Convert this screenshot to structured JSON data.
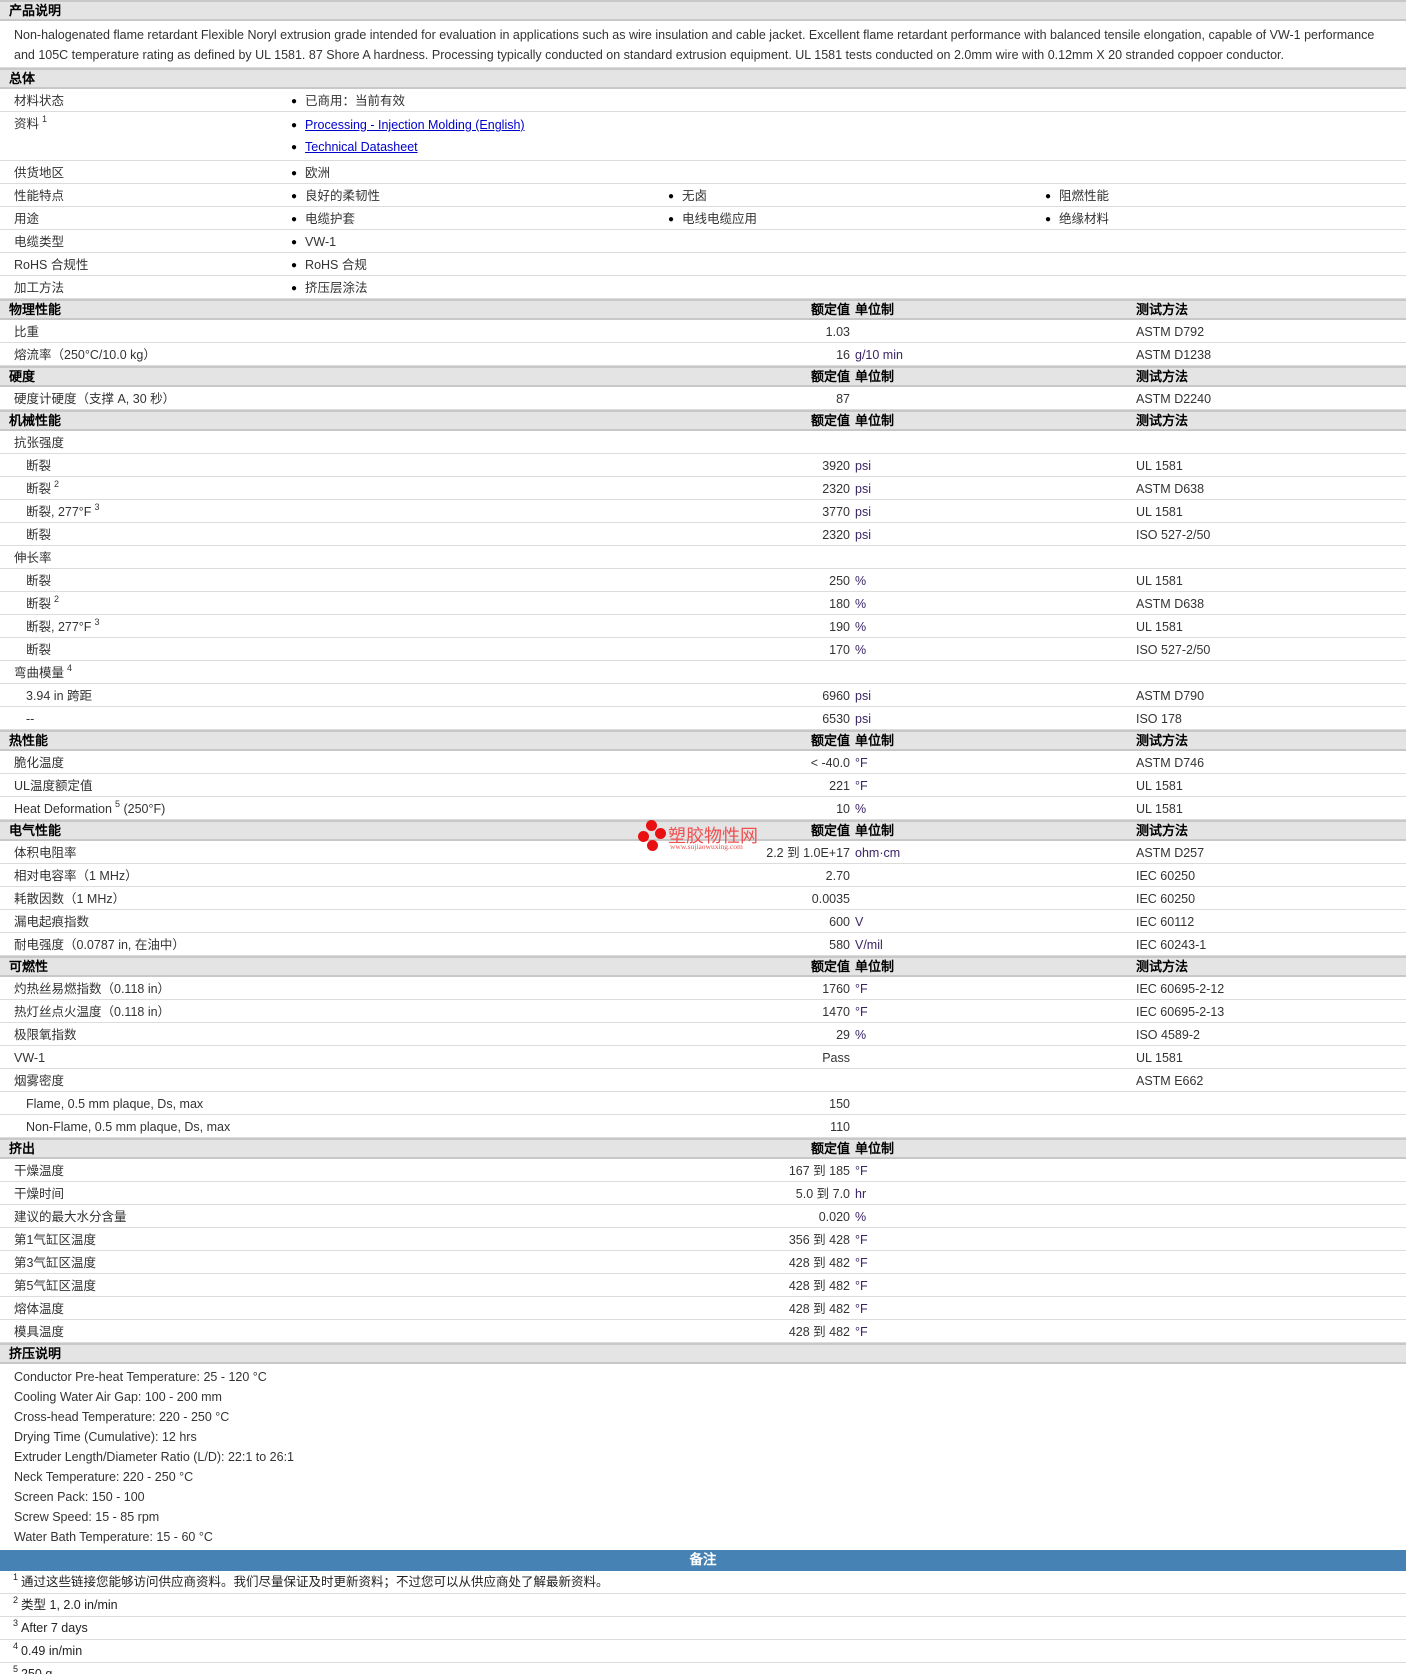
{
  "description": {
    "title": "产品说明",
    "text": "Non-halogenated flame retardant Flexible Noryl extrusion grade intended for evaluation in applications such as wire insulation and cable jacket. Excellent flame retardant performance with balanced tensile elongation, capable of VW-1 performance and 105C temperature rating as defined by UL 1581. 87 Shore A hardness. Processing typically conducted on standard extrusion equipment. UL 1581 tests conducted on 2.0mm wire with 0.12mm X 20 stranded coppoer conductor."
  },
  "general": {
    "title": "总体",
    "rows": [
      {
        "label": "材料状态",
        "items": [
          "已商用：当前有效"
        ]
      },
      {
        "label": "资料",
        "sup": "1",
        "links": [
          "Processing - Injection Molding (English)",
          "Technical Datasheet"
        ]
      },
      {
        "label": "供货地区",
        "items": [
          "欧洲"
        ]
      },
      {
        "label": "性能特点",
        "items": [
          "良好的柔韧性",
          "无卤",
          "阻燃性能"
        ]
      },
      {
        "label": "用途",
        "items": [
          "电缆护套",
          "电线电缆应用",
          "绝缘材料"
        ]
      },
      {
        "label": "电缆类型",
        "items": [
          "VW-1"
        ]
      },
      {
        "label": "RoHS 合规性",
        "items": [
          "RoHS 合规"
        ]
      },
      {
        "label": "加工方法",
        "items": [
          "挤压层涂法"
        ]
      }
    ]
  },
  "columns": {
    "value": "额定值",
    "unit": "单位制",
    "method": "测试方法"
  },
  "sections": [
    {
      "title": "物理性能",
      "method_col": true,
      "rows": [
        {
          "label": "比重",
          "value": "1.03",
          "unit": "",
          "method": "ASTM D792"
        },
        {
          "label": "熔流率（250°C/10.0 kg）",
          "value": "16",
          "unit": "g/10 min",
          "method": "ASTM D1238"
        }
      ]
    },
    {
      "title": "硬度",
      "method_col": true,
      "rows": [
        {
          "label": "硬度计硬度（支撑 A, 30 秒）",
          "value": "87",
          "unit": "",
          "method": "ASTM D2240"
        }
      ]
    },
    {
      "title": "机械性能",
      "method_col": true,
      "rows": [
        {
          "label": "抗张强度",
          "value": "",
          "unit": "",
          "method": ""
        },
        {
          "label": "断裂",
          "indent": true,
          "value": "3920",
          "unit": "psi",
          "method": "UL 1581"
        },
        {
          "label": "断裂",
          "indent": true,
          "sup": "2",
          "value": "2320",
          "unit": "psi",
          "method": "ASTM D638"
        },
        {
          "label": "断裂, 277°F",
          "indent": true,
          "sup": "3",
          "value": "3770",
          "unit": "psi",
          "method": "UL 1581"
        },
        {
          "label": "断裂",
          "indent": true,
          "value": "2320",
          "unit": "psi",
          "method": "ISO 527-2/50"
        },
        {
          "label": "伸长率",
          "value": "",
          "unit": "",
          "method": ""
        },
        {
          "label": "断裂",
          "indent": true,
          "value": "250",
          "unit": "%",
          "method": "UL 1581"
        },
        {
          "label": "断裂",
          "indent": true,
          "sup": "2",
          "value": "180",
          "unit": "%",
          "method": "ASTM D638"
        },
        {
          "label": "断裂, 277°F",
          "indent": true,
          "sup": "3",
          "value": "190",
          "unit": "%",
          "method": "UL 1581"
        },
        {
          "label": "断裂",
          "indent": true,
          "value": "170",
          "unit": "%",
          "method": "ISO 527-2/50"
        },
        {
          "label": "弯曲模量",
          "sup": "4",
          "value": "",
          "unit": "",
          "method": ""
        },
        {
          "label": "3.94 in 跨距",
          "indent": true,
          "value": "6960",
          "unit": "psi",
          "method": "ASTM D790"
        },
        {
          "label": "--",
          "indent": true,
          "value": "6530",
          "unit": "psi",
          "method": "ISO 178"
        }
      ]
    },
    {
      "title": "热性能",
      "method_col": true,
      "rows": [
        {
          "label": "脆化温度",
          "value": "< -40.0",
          "unit": "°F",
          "method": "ASTM D746"
        },
        {
          "label": "UL温度额定值",
          "value": "221",
          "unit": "°F",
          "method": "UL 1581"
        },
        {
          "label": "Heat Deformation",
          "sup": "5",
          "label_suffix": "(250°F)",
          "value": "10",
          "unit": "%",
          "method": "UL 1581"
        }
      ]
    },
    {
      "title": "电气性能",
      "method_col": true,
      "rows": [
        {
          "label": "体积电阻率",
          "value": "2.2 到  1.0E+17",
          "unit": "ohm·cm",
          "method": "ASTM D257"
        },
        {
          "label": "相对电容率（1 MHz）",
          "value": "2.70",
          "unit": "",
          "method": "IEC 60250"
        },
        {
          "label": "耗散因数（1 MHz）",
          "value": "0.0035",
          "unit": "",
          "method": "IEC 60250"
        },
        {
          "label": "漏电起痕指数",
          "value": "600",
          "unit": "V",
          "method": "IEC 60112"
        },
        {
          "label": "耐电强度（0.0787 in, 在油中）",
          "value": "580",
          "unit": "V/mil",
          "method": "IEC 60243-1"
        }
      ]
    },
    {
      "title": "可燃性",
      "method_col": true,
      "rows": [
        {
          "label": "灼热丝易燃指数（0.118 in）",
          "value": "1760",
          "unit": "°F",
          "method": "IEC 60695-2-12"
        },
        {
          "label": "热灯丝点火温度（0.118 in）",
          "value": "1470",
          "unit": "°F",
          "method": "IEC 60695-2-13"
        },
        {
          "label": "极限氧指数",
          "value": "29",
          "unit": "%",
          "method": "ISO 4589-2"
        },
        {
          "label": "VW-1",
          "value": "Pass",
          "unit": "",
          "method": "UL 1581"
        },
        {
          "label": "烟雾密度",
          "value": "",
          "unit": "",
          "method": "ASTM E662"
        },
        {
          "label": "Flame, 0.5 mm plaque, Ds, max",
          "indent": true,
          "value": "150",
          "unit": "",
          "method": ""
        },
        {
          "label": "Non-Flame, 0.5 mm plaque, Ds, max",
          "indent": true,
          "value": "110",
          "unit": "",
          "method": ""
        }
      ]
    },
    {
      "title": "挤出",
      "method_col": false,
      "rows": [
        {
          "label": "干燥温度",
          "value": "167 到  185",
          "unit": "°F",
          "method": ""
        },
        {
          "label": "干燥时间",
          "value": "5.0 到  7.0",
          "unit": "hr",
          "method": ""
        },
        {
          "label": "建议的最大水分含量",
          "value": "0.020",
          "unit": "%",
          "method": ""
        },
        {
          "label": "第1气缸区温度",
          "value": "356 到  428",
          "unit": "°F",
          "method": ""
        },
        {
          "label": "第3气缸区温度",
          "value": "428 到  482",
          "unit": "°F",
          "method": ""
        },
        {
          "label": "第5气缸区温度",
          "value": "428 到  482",
          "unit": "°F",
          "method": ""
        },
        {
          "label": "熔体温度",
          "value": "428 到  482",
          "unit": "°F",
          "method": ""
        },
        {
          "label": "模具温度",
          "value": "428 到  482",
          "unit": "°F",
          "method": ""
        }
      ]
    }
  ],
  "extrusion_notes": {
    "title": "挤压说明",
    "lines": [
      "Conductor Pre-heat Temperature: 25 - 120 °C",
      "Cooling Water Air Gap: 100 - 200 mm",
      "Cross-head Temperature: 220 - 250 °C",
      "Drying Time (Cumulative): 12 hrs",
      "Extruder Length/Diameter Ratio (L/D): 22:1 to 26:1",
      "Neck Temperature: 220 - 250 °C",
      "Screen Pack: 150 - 100",
      "Screw Speed: 15 - 85 rpm",
      "Water Bath Temperature: 15 - 60 °C"
    ]
  },
  "notes": {
    "title": "备注",
    "items": [
      {
        "num": "1",
        "text": "通过这些链接您能够访问供应商资料。我们尽量保证及时更新资料；不过您可以从供应商处了解最新资料。"
      },
      {
        "num": "2",
        "text": "类型  1, 2.0 in/min"
      },
      {
        "num": "3",
        "text": "After 7 days"
      },
      {
        "num": "4",
        "text": "0.49 in/min"
      },
      {
        "num": "5",
        "text": "250 g"
      }
    ]
  },
  "watermark": {
    "name": "塑胶物性网",
    "url": "www.sujiaowuxing.com"
  },
  "colors": {
    "header_bg": "#e4e4e4",
    "notes_bar": "#4682b4",
    "link": "#0000cc"
  }
}
